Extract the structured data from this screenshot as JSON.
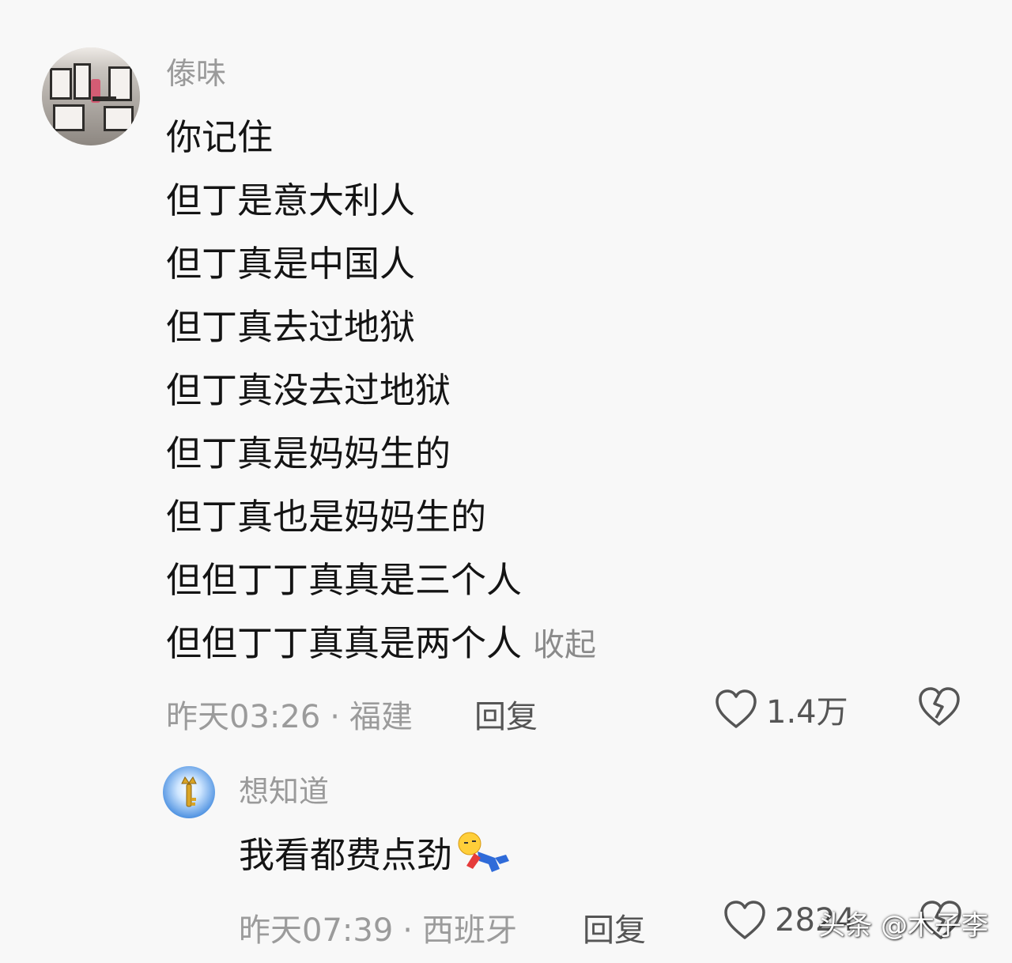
{
  "comment": {
    "username": "傣味",
    "lines": [
      "你记住",
      "但丁是意大利人",
      "但丁真是中国人",
      "但丁真去过地狱",
      "但丁真没去过地狱",
      "但丁真是妈妈生的",
      "但丁真也是妈妈生的",
      "但但丁丁真真是三个人",
      "但但丁丁真真是两个人"
    ],
    "collapse_label": "收起",
    "time": "昨天03:26",
    "separator": "·",
    "location": "福建",
    "reply_label": "回复",
    "likes": "1.4万"
  },
  "reply": {
    "username": "想知道",
    "text": "我看都费点劲",
    "time": "昨天07:39",
    "separator": "·",
    "location": "西班牙",
    "reply_label": "回复",
    "likes": "2824"
  },
  "watermark": "头条 @木子李",
  "colors": {
    "background": "#f8f8f8",
    "text": "#141414",
    "meta": "#9b9b9b"
  }
}
